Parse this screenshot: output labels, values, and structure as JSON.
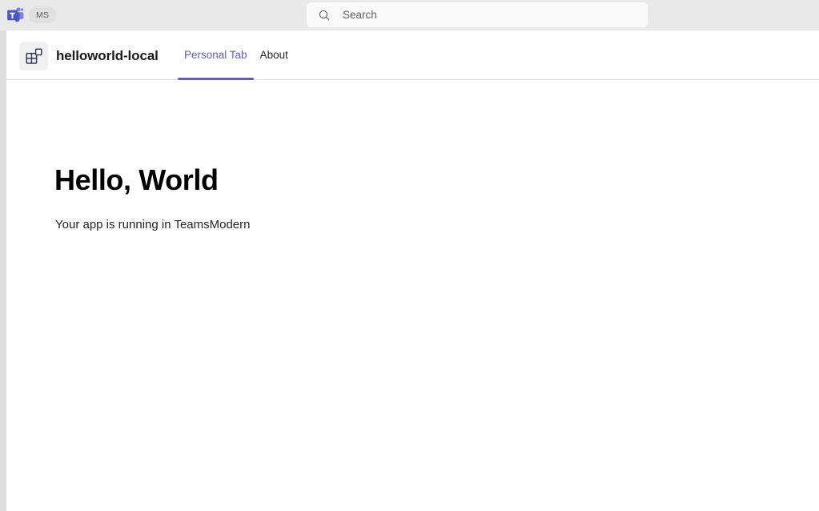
{
  "topbar": {
    "logo_icon": "microsoft-teams-logo",
    "org_badge": "MS",
    "search": {
      "icon": "search-icon",
      "placeholder": "Search",
      "value": ""
    }
  },
  "app": {
    "icon": "app-grid-icon",
    "title": "helloworld-local",
    "tabs": [
      {
        "label": "Personal Tab",
        "active": true
      },
      {
        "label": "About",
        "active": false
      }
    ]
  },
  "content": {
    "heading": "Hello, World",
    "subtitle": "Your app is running in TeamsModern"
  },
  "colors": {
    "accent": "#5b5fc7",
    "topbar_bg": "#e9e9e9",
    "gutter": "#dedede",
    "stage_bg": "#ffffff",
    "app_icon_glyph": "#303b54"
  }
}
